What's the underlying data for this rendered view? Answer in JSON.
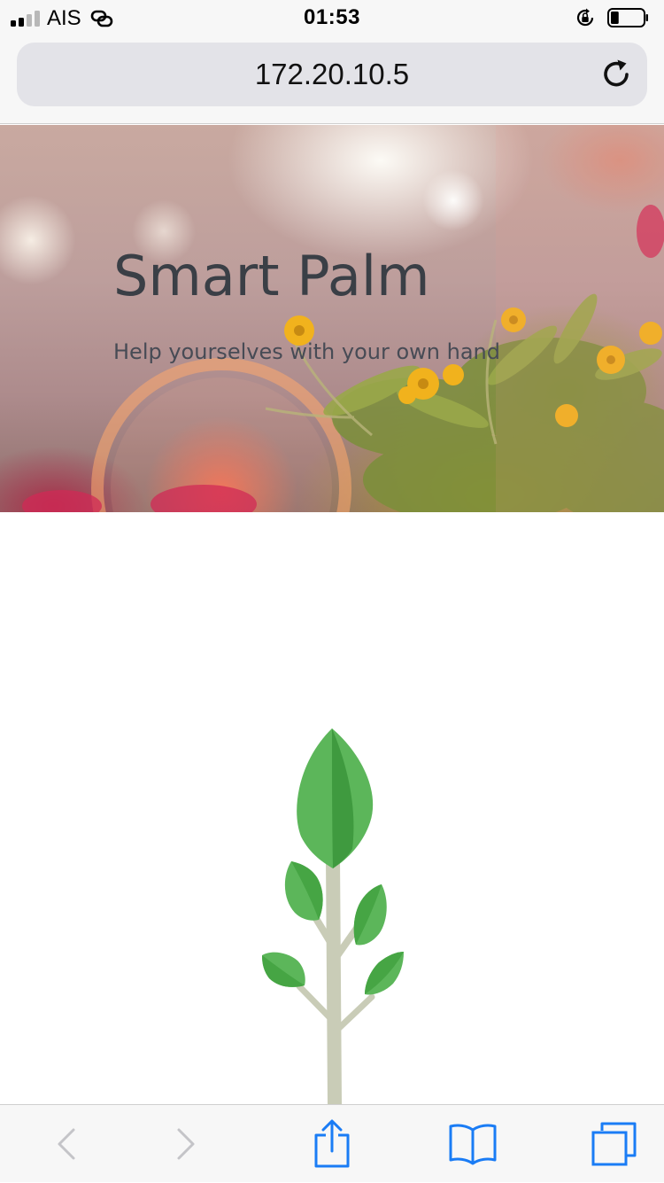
{
  "status_bar": {
    "carrier": "AIS",
    "time": "01:53",
    "icons": [
      "signal-icon",
      "link-icon",
      "rotation-lock-icon",
      "battery-icon"
    ],
    "signal_bars_filled": 2,
    "signal_bars_total": 4,
    "battery_level": 0.25
  },
  "address_bar": {
    "url": "172.20.10.5",
    "reload_icon": "reload-icon"
  },
  "hero": {
    "title": "Smart Palm",
    "subtitle": "Help yourselves with your own hand"
  },
  "content": {
    "illustration": "sapling-icon",
    "colors": {
      "leaf": "#5cb65a",
      "leaf_dark": "#3f9a3f",
      "stem": "#c9ccb7"
    }
  },
  "toolbar": {
    "buttons": [
      {
        "icon": "back-icon",
        "enabled": false
      },
      {
        "icon": "forward-icon",
        "enabled": false
      },
      {
        "icon": "share-icon",
        "enabled": true
      },
      {
        "icon": "bookmarks-icon",
        "enabled": true
      },
      {
        "icon": "tabs-icon",
        "enabled": true
      }
    ],
    "colors": {
      "accent": "#1a7cf5",
      "disabled": "#c4c4c8"
    }
  }
}
